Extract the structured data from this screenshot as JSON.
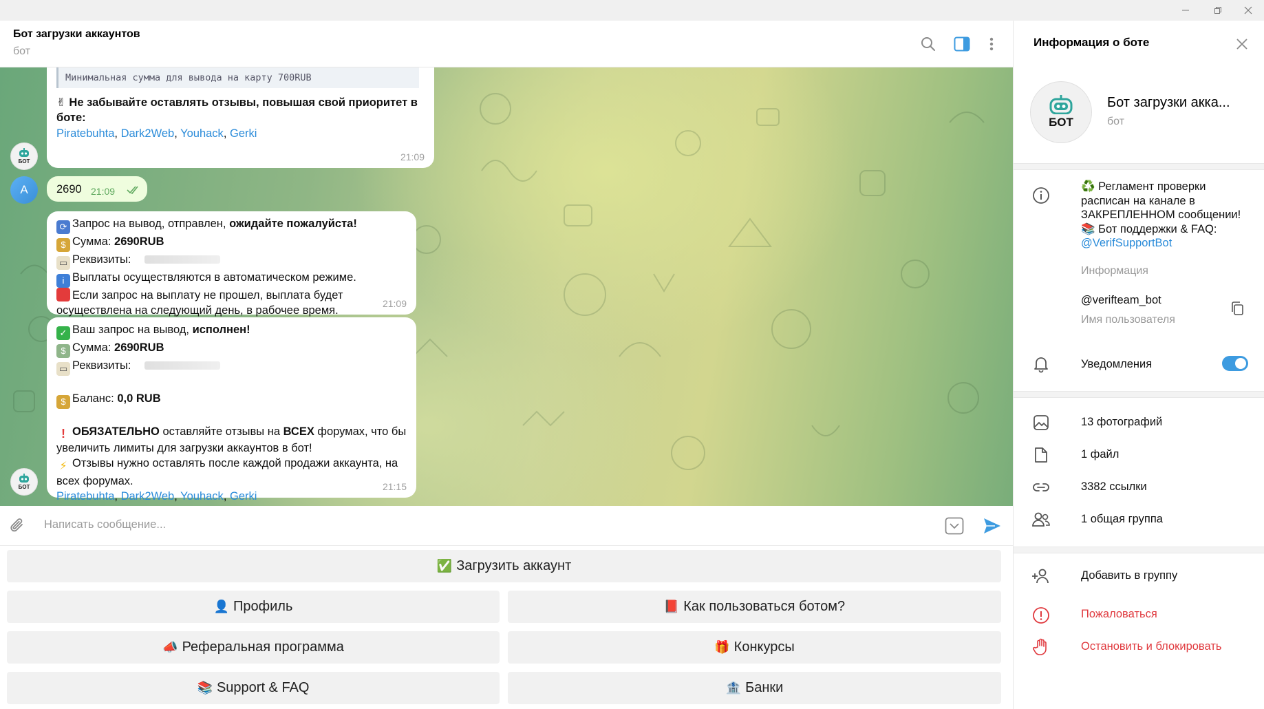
{
  "header": {
    "title": "Бот загрузки аккаунтов",
    "subtitle": "бот"
  },
  "messages": {
    "m0": {
      "code_line": "Минимальная сумма для вывода на карту 700RUB",
      "emoji": "✌",
      "text": "Не забывайте оставлять отзывы, повышая свой приоритет в боте:",
      "links": [
        "Piratebuhta",
        "Dark2Web",
        "Youhack",
        "Gerki"
      ],
      "time": "21:09"
    },
    "m1": {
      "avatar_letter": "A",
      "text": "2690",
      "time": "21:09"
    },
    "m2": {
      "line1_a": "Запрос на вывод,  отправлен,",
      "line1_b": "ожидайте пожалуйста!",
      "line2_a": "Сумма:",
      "line2_b": "2690RUB",
      "line3": "Реквизиты:",
      "line4": "Выплаты осуществляются в автоматическом режиме.",
      "line5": "Если запрос на выплату не прошел, выплата будет",
      "line6": "осуществлена на следующий день, в рабочее время.",
      "time": "21:09"
    },
    "m3": {
      "line1_a": "Ваш запрос на вывод,",
      "line1_b": "исполнен!",
      "line2_a": "Сумма:",
      "line2_b": "2690RUB",
      "line3": "Реквизиты:",
      "line4_a": "Баланс:",
      "line4_b": "0,0 RUB",
      "line5_a": "ОБЯЗАТЕЛЬНО",
      "line5_b": "оставляйте отзывы на",
      "line5_c": "ВСЕХ",
      "line5_d": "форумах, что бы",
      "line6": "увеличить лимиты для загрузки аккаунтов в бот!",
      "line7": "Отзывы нужно оставлять после каждой продажи аккаунта, на",
      "line8": "всех форумах.",
      "links": [
        "Piratebuhta",
        "Dark2Web",
        "Youhack",
        "Gerki"
      ],
      "time": "21:15"
    }
  },
  "avatar_label": "БОТ",
  "composer": {
    "placeholder": "Написать сообщение..."
  },
  "keyboard": [
    {
      "emoji": "✅",
      "label": "Загрузить аккаунт"
    },
    {
      "emoji": "👤",
      "label": "Профиль"
    },
    {
      "emoji": "📕",
      "label": "Как пользоваться ботом?"
    },
    {
      "emoji": "📣",
      "label": "Реферальная программа"
    },
    {
      "emoji": "🎁",
      "label": "Конкурсы"
    },
    {
      "emoji": "📚",
      "label": "Support & FAQ"
    },
    {
      "emoji": "🏦",
      "label": "Банки"
    }
  ],
  "side": {
    "title": "Информация о боте",
    "name": "Бот загрузки акка...",
    "subtitle": "бот",
    "info_lines": [
      "♻️ Регламент проверки",
      "расписан на канале в",
      "ЗАКРЕПЛЕННОМ сообщении!",
      "📚 Бот поддержки & FAQ:"
    ],
    "info_link": "@VerifSupportBot",
    "info_label": "Информация",
    "username": "@verifteam_bot",
    "username_label": "Имя пользователя",
    "notifications": "Уведомления",
    "notifications_on": true,
    "media": [
      "13 фотографий",
      "1 файл",
      "3382 ссылки",
      "1 общая группа"
    ],
    "add_to_group": "Добавить в группу",
    "report": "Пожаловаться",
    "block": "Остановить и блокировать"
  },
  "colors": {
    "accent": "#3d9be0",
    "link": "#2a8bd9",
    "danger": "#e0393e",
    "bubble": "#ffffff",
    "own_bubble": "#effdde"
  }
}
